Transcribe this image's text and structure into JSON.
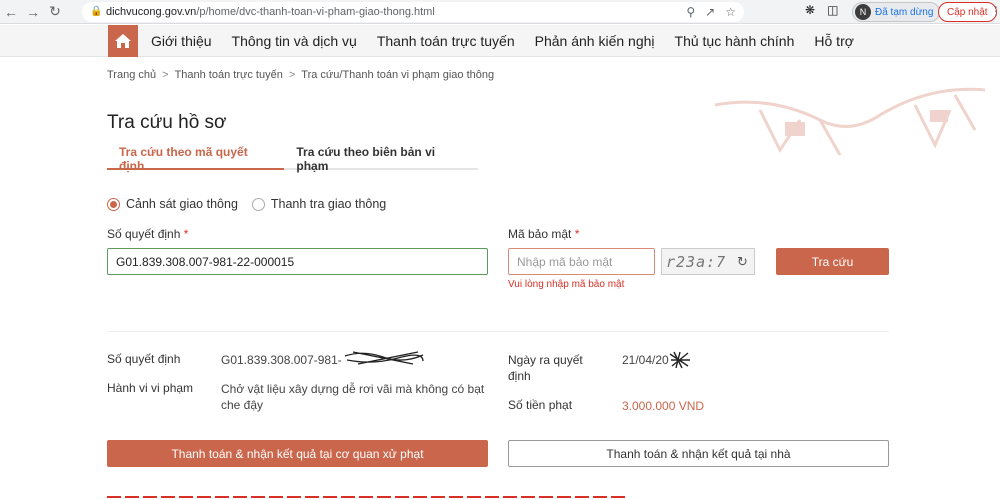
{
  "browser": {
    "url_domain": "dichvucong.gov.vn",
    "url_path": "/p/home/dvc-thanh-toan-vi-pham-giao-thong.html",
    "profile_initial": "N",
    "profile_status": "Đã tạm dừng",
    "update_label": "Cập nhật"
  },
  "nav": {
    "items": [
      "Giới thiệu",
      "Thông tin và dịch vụ",
      "Thanh toán trực tuyến",
      "Phản ánh kiến nghị",
      "Thủ tục hành chính",
      "Hỗ trợ"
    ]
  },
  "breadcrumb": [
    "Trang chủ",
    "Thanh toán trực tuyến",
    "Tra cứu/Thanh toán vi phạm giao thông"
  ],
  "page_title": "Tra cứu hồ sơ",
  "tabs": [
    "Tra cứu theo mã quyết định",
    "Tra cứu theo biên bản vi phạm"
  ],
  "radios": [
    "Cảnh sát giao thông",
    "Thanh tra giao thông"
  ],
  "form": {
    "decision_label": "Số quyết định",
    "decision_value": "G01.839.308.007-981-22-000015",
    "captcha_label": "Mã bảo mật",
    "captcha_placeholder": "Nhập mã bảo mật",
    "captcha_text": "r23a:7",
    "search_button": "Tra cứu",
    "error": "Vui lòng nhập mã bảo mật",
    "required_mark": "*"
  },
  "result": {
    "decision_key": "Số quyết định",
    "decision_value": "G01.839.308.007-981-",
    "violation_key": "Hành vi vi phạm",
    "violation_value": "Chở vật liệu xây dựng dễ rơi vãi mà không có bạt che đậy",
    "date_key": "Ngày ra quyết định",
    "date_value": "21/04/20",
    "fine_key": "Số tiền phạt",
    "fine_value": "3.000.000 VND"
  },
  "buttons": {
    "pay_agency": "Thanh toán & nhận kết quả tại cơ quan xử phạt",
    "pay_home": "Thanh toán & nhận kết quả tại nhà"
  },
  "colors": {
    "accent": "#c9664b",
    "error": "#d93025"
  }
}
